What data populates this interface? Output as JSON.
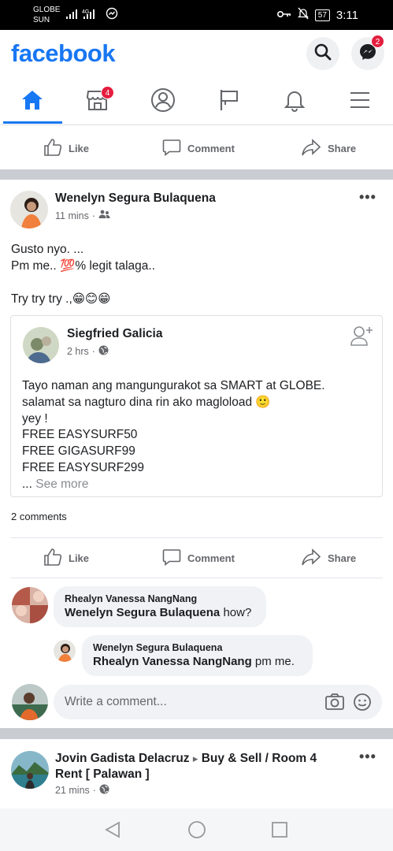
{
  "status": {
    "carrier_top": "GLOBE",
    "carrier_bottom": "SUN",
    "network": "4G",
    "battery": "57",
    "time": "3:11"
  },
  "header": {
    "logo": "facebook",
    "messenger_badge": "2"
  },
  "nav": {
    "marketplace_badge": "4",
    "active_tab": "home"
  },
  "actions": {
    "like": "Like",
    "comment": "Comment",
    "share": "Share"
  },
  "post": {
    "author": "Wenelyn Segura Bulaquena",
    "time": "11 mins",
    "line1": "Gusto nyo. ...",
    "line2_pre": "Pm me.. ",
    "line2_emoji": "💯",
    "line2_post": "% legit talaga..",
    "line3": "Try try try .,😁😊😁",
    "shared": {
      "author": "Siegfried Galicia",
      "time": "2 hrs",
      "lines": [
        "Tayo naman ang mangungurakot sa SMART at GLOBE.",
        "salamat sa nagturo dina rin ako magloload 🙂",
        "yey !",
        "FREE EASYSURF50",
        "FREE GIGASURF99",
        "FREE EASYSURF299"
      ],
      "ellipsis": "...",
      "see_more": "See more"
    },
    "comments_count": "2 comments",
    "comments": [
      {
        "author": "Rhealyn Vanessa NangNang",
        "mention": "Wenelyn Segura Bulaquena",
        "text": "how?"
      },
      {
        "author": "Wenelyn Segura Bulaquena",
        "mention": "Rhealyn Vanessa NangNang",
        "text": "pm me."
      }
    ],
    "write_placeholder": "Write a comment..."
  },
  "next_post": {
    "author": "Jovin Gadista Delacruz",
    "arrow": "▸",
    "group_line1": "Buy & Sell / Room 4",
    "group_line2": "Rent [ Palawan ]",
    "time": "21 mins"
  },
  "colors": {
    "brand": "#1877f2",
    "badge": "#e41e3f",
    "separator": "#c9ccd1"
  }
}
